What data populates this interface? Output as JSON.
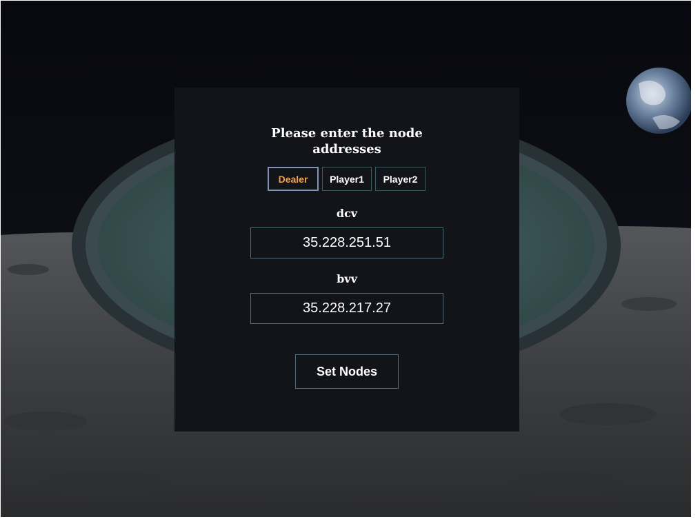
{
  "modal": {
    "title_line1": "Please enter the node",
    "title_line2": "addresses"
  },
  "tabs": [
    {
      "label": "Dealer",
      "active": true
    },
    {
      "label": "Player1",
      "active": false
    },
    {
      "label": "Player2",
      "active": false
    }
  ],
  "fields": [
    {
      "label": "dcv",
      "value": "35.228.251.51"
    },
    {
      "label": "bvv",
      "value": "35.228.217.27"
    }
  ],
  "actions": {
    "set_nodes_label": "Set Nodes"
  },
  "colors": {
    "modal_bg": "#131419",
    "active_tab_text": "#f0a34a",
    "border": "#4f6e77",
    "table_felt": "#3e5a59"
  }
}
